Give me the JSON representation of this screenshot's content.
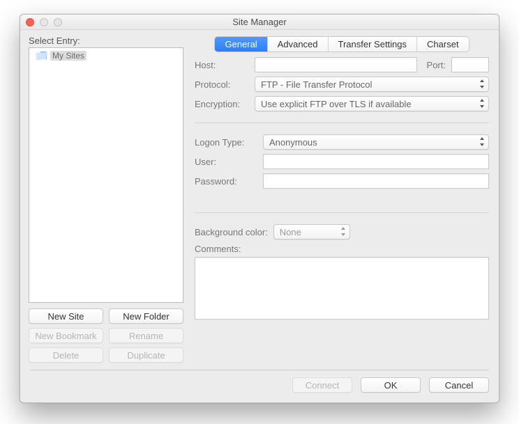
{
  "window": {
    "title": "Site Manager"
  },
  "left": {
    "heading": "Select Entry:",
    "tree_root": "My Sites",
    "buttons": {
      "new_site": "New Site",
      "new_folder": "New Folder",
      "new_bookmark": "New Bookmark",
      "rename": "Rename",
      "delete": "Delete",
      "duplicate": "Duplicate"
    }
  },
  "tabs": {
    "general": "General",
    "advanced": "Advanced",
    "transfer": "Transfer Settings",
    "charset": "Charset"
  },
  "form": {
    "host_label": "Host:",
    "host_value": "",
    "port_label": "Port:",
    "port_value": "",
    "protocol_label": "Protocol:",
    "protocol_value": "FTP - File Transfer Protocol",
    "encryption_label": "Encryption:",
    "encryption_value": "Use explicit FTP over TLS if available",
    "logon_label": "Logon Type:",
    "logon_value": "Anonymous",
    "user_label": "User:",
    "user_value": "",
    "password_label": "Password:",
    "password_value": "",
    "bgcolor_label": "Background color:",
    "bgcolor_value": "None",
    "comments_label": "Comments:",
    "comments_value": ""
  },
  "footer": {
    "connect": "Connect",
    "ok": "OK",
    "cancel": "Cancel"
  }
}
